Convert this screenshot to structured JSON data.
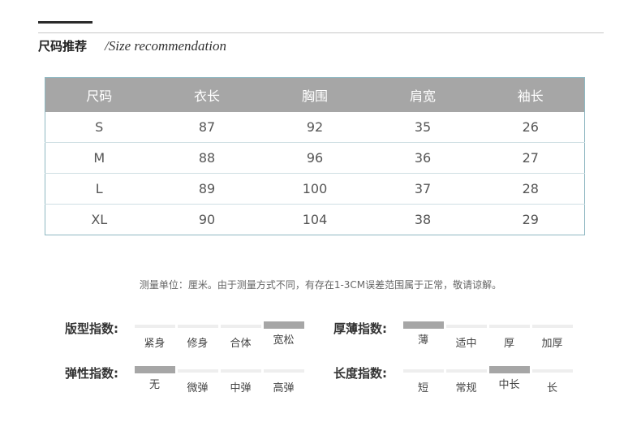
{
  "heading": {
    "cn": "尺码推荐",
    "en": "/Size recommendation"
  },
  "table": {
    "headers": [
      "尺码",
      "衣长",
      "胸围",
      "肩宽",
      "袖长"
    ],
    "rows": [
      [
        "S",
        "87",
        "92",
        "35",
        "26"
      ],
      [
        "M",
        "88",
        "96",
        "36",
        "27"
      ],
      [
        "L",
        "89",
        "100",
        "37",
        "28"
      ],
      [
        "XL",
        "90",
        "104",
        "38",
        "29"
      ]
    ]
  },
  "note": "测量单位：厘米。由于测量方式不同，有存在1-3CM误差范围属于正常，敬请谅解。",
  "indices": {
    "fit": {
      "label": "版型指数:",
      "options": [
        "紧身",
        "修身",
        "合体",
        "宽松"
      ],
      "selected": 3
    },
    "thickness": {
      "label": "厚薄指数:",
      "options": [
        "薄",
        "适中",
        "厚",
        "加厚"
      ],
      "selected": 0
    },
    "elasticity": {
      "label": "弹性指数:",
      "options": [
        "无",
        "微弹",
        "中弹",
        "高弹"
      ],
      "selected": 0
    },
    "length": {
      "label": "长度指数:",
      "options": [
        "短",
        "常规",
        "中长",
        "长"
      ],
      "selected": 2
    }
  },
  "colors": {
    "header_bg": "#a6a6a6",
    "selected_bar": "#a6a6a6",
    "unselected_bar": "#eeeeee",
    "table_border": "#8fb8c2"
  }
}
